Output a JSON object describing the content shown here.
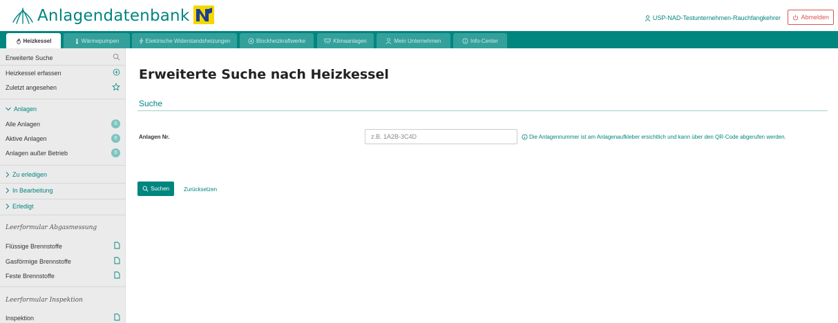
{
  "header": {
    "app_title": "Anlagendatenbank",
    "user_label": "USP-NAD-Testunternehmen-Rauchfangkehrer",
    "logout_label": "Abmelden"
  },
  "tabs": [
    {
      "label": "Heizkessel",
      "icon": "flame-icon",
      "active": true
    },
    {
      "label": "Wärmepumpen",
      "icon": "thermometer-icon",
      "active": false
    },
    {
      "label": "Elektrische Widerstandsheizungen",
      "icon": "lightning-icon",
      "active": false
    },
    {
      "label": "Blockheizkraftwerke",
      "icon": "plant-icon",
      "active": false
    },
    {
      "label": "Klimaanlagen",
      "icon": "aircon-icon",
      "active": false
    },
    {
      "label": "Mein Unternehmen",
      "icon": "user-icon",
      "active": false
    },
    {
      "label": "Info-Center",
      "icon": "info-icon",
      "active": false
    }
  ],
  "sidebar": {
    "search": "Erweiterte Suche",
    "add": "Heizkessel erfassen",
    "recent": "Zuletzt angesehen",
    "anlagen_head": "Anlagen",
    "anlagen": [
      {
        "label": "Alle Anlagen",
        "count": "0"
      },
      {
        "label": "Aktive Anlagen",
        "count": "0"
      },
      {
        "label": "Anlagen außer Betrieb",
        "count": "0"
      }
    ],
    "todo": "Zu erledigen",
    "in_progress": "In Bearbeitung",
    "done": "Erledigt",
    "form_abgas_head": "Leerformular Abgasmessung",
    "form_abgas": [
      "Flüssige Brennstoffe",
      "Gasförmige Brennstoffe",
      "Feste Brennstoffe"
    ],
    "form_inspektion_head": "Leerformular Inspektion",
    "form_inspektion": [
      "Inspektion"
    ]
  },
  "main": {
    "title": "Erweiterte Suche nach Heizkessel",
    "section": "Suche",
    "field_label": "Anlagen Nr.",
    "field_placeholder": "z.B. 1A2B-3C4D",
    "field_value": "",
    "hint": "Die Anlagennummer ist am Anlagenaufkleber ersichtlich und kann über den QR-Code abgerufen werden.",
    "search_button": "Suchen",
    "reset_link": "Zurücksetzen"
  },
  "colors": {
    "brand": "#00857f",
    "tab_inactive": "#33a09b",
    "danger": "#d9534f",
    "sidebar_bg": "#ebebeb"
  }
}
